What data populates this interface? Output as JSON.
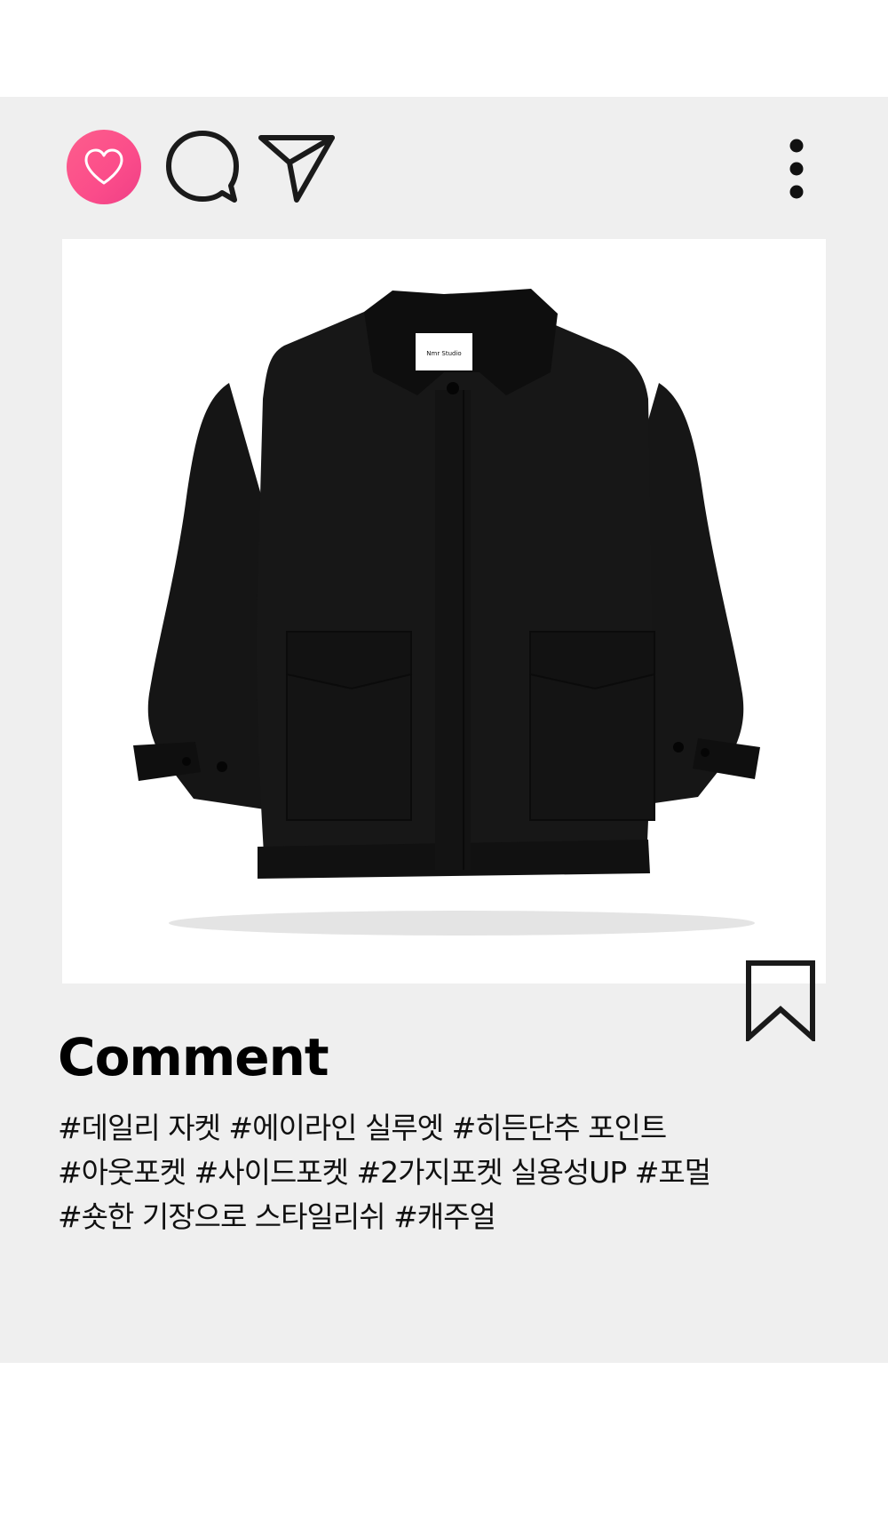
{
  "post": {
    "icons": {
      "like": "heart-icon",
      "comment": "speech-bubble-icon",
      "share": "paper-plane-icon",
      "more": "vertical-dots-icon",
      "bookmark": "bookmark-icon"
    },
    "colors": {
      "card_background": "#efefef",
      "like_accent": "#fb4c8a",
      "icon_stroke": "#222222",
      "jacket": "#141414"
    },
    "image": {
      "label_text": "Nmr Studio"
    },
    "comment_title": "Comment",
    "hashtags": [
      "#데일리 자켓 #에이라인 실루엣  #히든단추 포인트",
      "#아웃포켓  #사이드포켓 #2가지포켓 실용성UP #포멀",
      "#숏한 기장으로 스타일리쉬 #캐주얼"
    ]
  }
}
